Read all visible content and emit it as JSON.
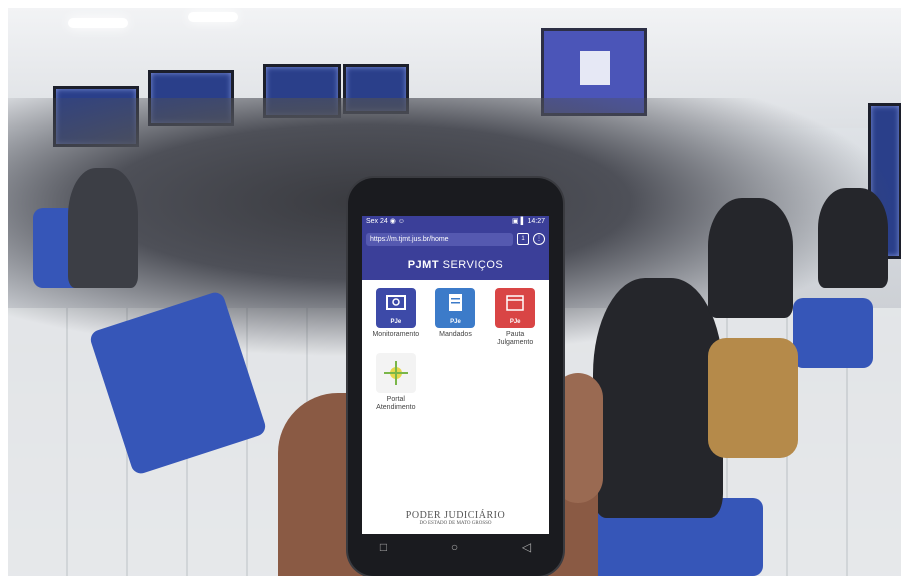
{
  "phone": {
    "status_left": "Sex 24 ◉ ☺",
    "status_right": "▣ ▌ 14:27",
    "url": "https://m.tjmt.jus.br/home",
    "header_bold": "PJMT",
    "header_light": " SERVIÇOS",
    "tiles": [
      {
        "label": "Monitoramento",
        "badge": "PJe",
        "color": "#3d4aa8"
      },
      {
        "label": "Mandados",
        "badge": "PJe",
        "color": "#3c7bc9"
      },
      {
        "label": "Pauta Julgamento",
        "badge": "PJe",
        "color": "#d94545"
      },
      {
        "label": "Portal Atendimento",
        "badge": "",
        "color": "#f3f3f3"
      }
    ],
    "footer_title": "PODER JUDICIÁRIO",
    "footer_sub": "DO ESTADO DE MATO GROSSO"
  }
}
